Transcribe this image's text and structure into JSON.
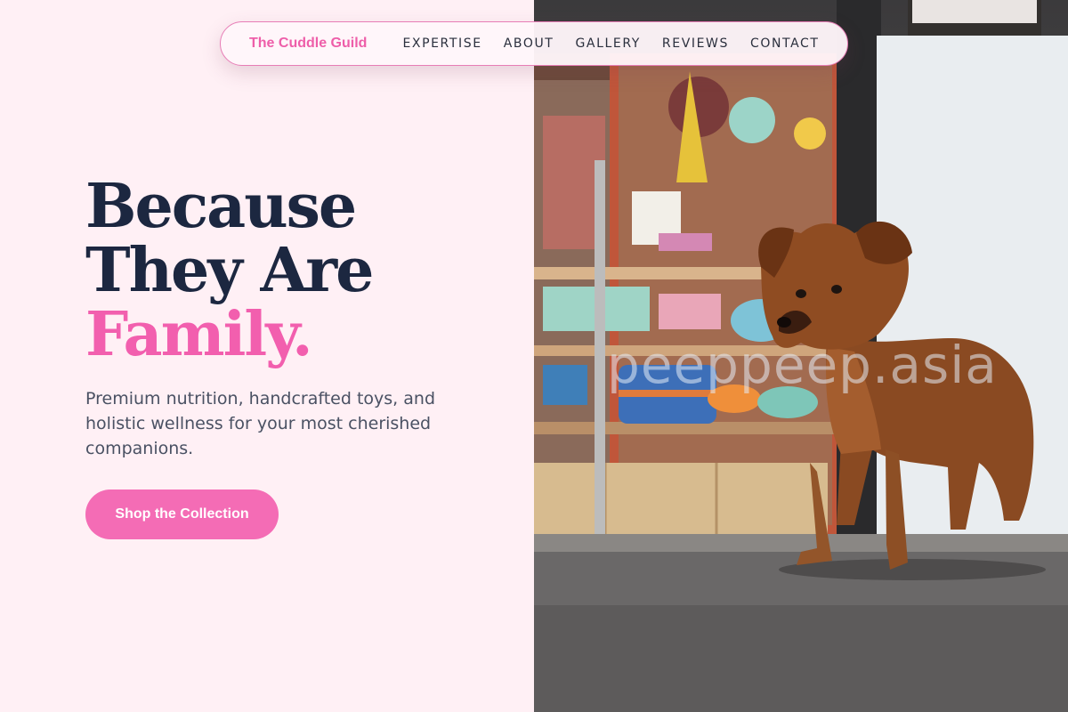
{
  "nav": {
    "brand": "The Cuddle Guild",
    "links": [
      "EXPERTISE",
      "ABOUT",
      "GALLERY",
      "REVIEWS",
      "CONTACT"
    ]
  },
  "hero": {
    "headline_line1": "Because",
    "headline_line2": "They Are",
    "headline_accent": "Family.",
    "subtext": "Premium nutrition, handcrafted toys, and holistic wellness for your most cherished companions.",
    "cta_label": "Shop the Collection"
  },
  "photo": {
    "watermark": "peeppeep.asia"
  },
  "colors": {
    "accent": "#f46cb5",
    "brand": "#ee5ea9",
    "headline": "#1c2740",
    "background": "#fff0f5"
  }
}
